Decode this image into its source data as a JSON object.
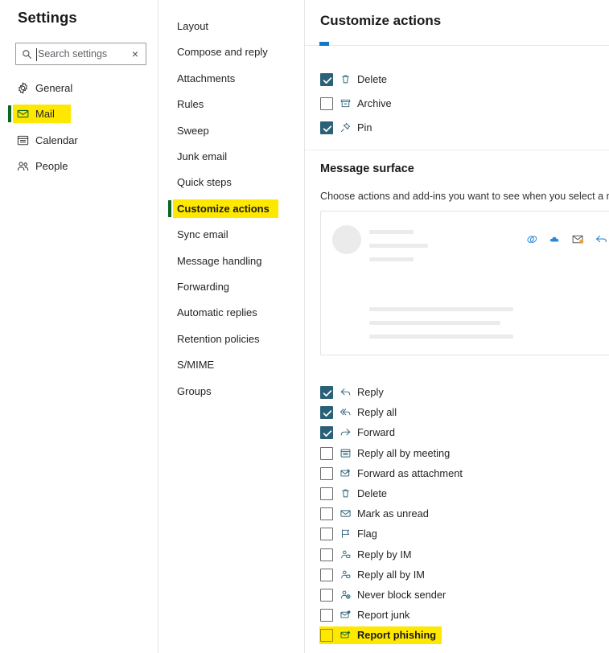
{
  "sidebar": {
    "title": "Settings",
    "search": {
      "placeholder": "Search settings",
      "value": "",
      "clear_glyph": "×"
    },
    "items": [
      {
        "label": "General",
        "icon": "gear-icon",
        "selected": false
      },
      {
        "label": "Mail",
        "icon": "envelope-icon",
        "selected": true
      },
      {
        "label": "Calendar",
        "icon": "calendar-icon",
        "selected": false
      },
      {
        "label": "People",
        "icon": "people-icon",
        "selected": false
      }
    ]
  },
  "midnav": {
    "items": [
      {
        "label": "Layout",
        "selected": false
      },
      {
        "label": "Compose and reply",
        "selected": false
      },
      {
        "label": "Attachments",
        "selected": false
      },
      {
        "label": "Rules",
        "selected": false
      },
      {
        "label": "Sweep",
        "selected": false
      },
      {
        "label": "Junk email",
        "selected": false
      },
      {
        "label": "Quick steps",
        "selected": false
      },
      {
        "label": "Customize actions",
        "selected": true
      },
      {
        "label": "Sync email",
        "selected": false
      },
      {
        "label": "Message handling",
        "selected": false
      },
      {
        "label": "Forwarding",
        "selected": false
      },
      {
        "label": "Automatic replies",
        "selected": false
      },
      {
        "label": "Retention policies",
        "selected": false
      },
      {
        "label": "S/MIME",
        "selected": false
      },
      {
        "label": "Groups",
        "selected": false
      }
    ]
  },
  "main": {
    "title": "Customize actions",
    "top_actions": [
      {
        "label": "Delete",
        "icon": "trash-icon",
        "checked": true
      },
      {
        "label": "Archive",
        "icon": "archive-icon",
        "checked": false
      },
      {
        "label": "Pin",
        "icon": "pin-icon",
        "checked": true
      }
    ],
    "message_surface": {
      "title": "Message surface",
      "description": "Choose actions and add-ins you want to see when you select a m",
      "preview_icons": [
        "addin-diamond-icon",
        "cloud-icon",
        "envelope-badge-icon",
        "reply-arrow-icon"
      ]
    },
    "surface_actions": [
      {
        "label": "Reply",
        "icon": "reply-icon",
        "checked": true,
        "highlighted": false
      },
      {
        "label": "Reply all",
        "icon": "reply-all-icon",
        "checked": true,
        "highlighted": false
      },
      {
        "label": "Forward",
        "icon": "forward-icon",
        "checked": true,
        "highlighted": false
      },
      {
        "label": "Reply all by meeting",
        "icon": "calendar-icon",
        "checked": false,
        "highlighted": false
      },
      {
        "label": "Forward as attachment",
        "icon": "envelope-forward-icon",
        "checked": false,
        "highlighted": false
      },
      {
        "label": "Delete",
        "icon": "trash-icon",
        "checked": false,
        "highlighted": false
      },
      {
        "label": "Mark as unread",
        "icon": "envelope-icon",
        "checked": false,
        "highlighted": false
      },
      {
        "label": "Flag",
        "icon": "flag-icon",
        "checked": false,
        "highlighted": false
      },
      {
        "label": "Reply by IM",
        "icon": "person-im-icon",
        "checked": false,
        "highlighted": false
      },
      {
        "label": "Reply all by IM",
        "icon": "person-im-icon",
        "checked": false,
        "highlighted": false
      },
      {
        "label": "Never block sender",
        "icon": "person-add-icon",
        "checked": false,
        "highlighted": false
      },
      {
        "label": "Report junk",
        "icon": "envelope-alert-icon",
        "checked": false,
        "highlighted": false
      },
      {
        "label": "Report phishing",
        "icon": "envelope-phish-icon",
        "checked": false,
        "highlighted": true
      }
    ]
  },
  "colors": {
    "highlight_yellow": "#ffe800",
    "accent_green": "#0b6623",
    "checkbox_checked": "#2a6178",
    "icon_blue": "#2a6178"
  }
}
